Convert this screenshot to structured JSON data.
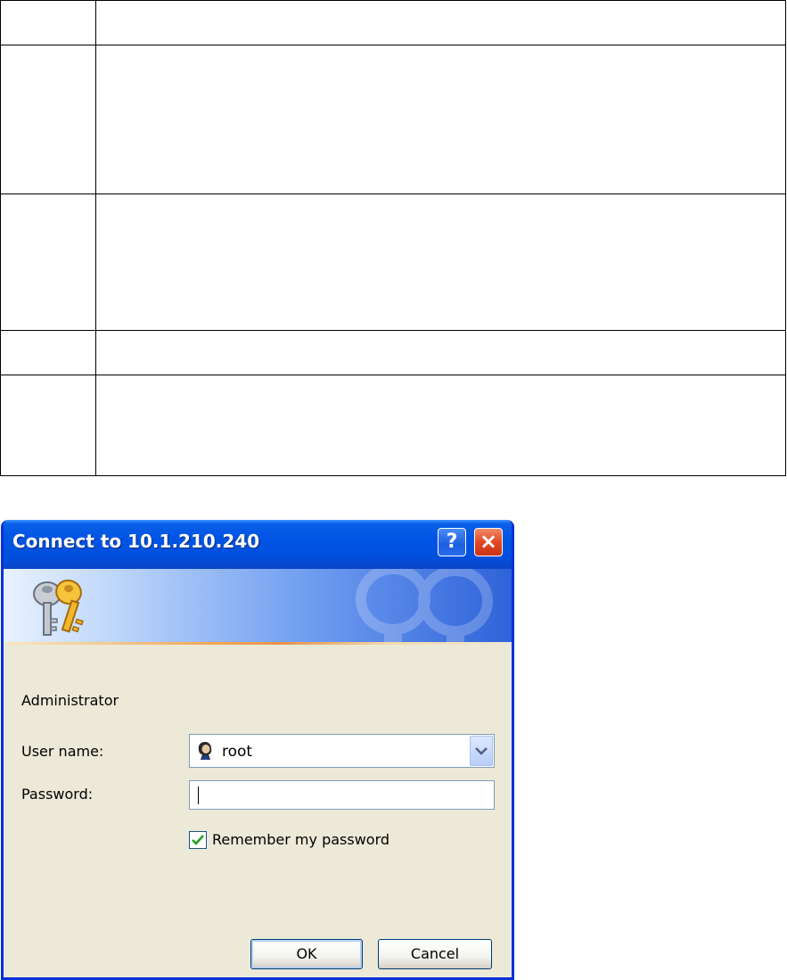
{
  "document": {
    "rows": 5
  },
  "dialog": {
    "title": "Connect to 10.1.210.240",
    "help_button": "?",
    "close_button": "×",
    "realm": "Administrator",
    "username_label": "User name:",
    "username_value": "root",
    "password_label": "Password:",
    "password_value": "",
    "remember_label": "Remember my password",
    "remember_checked": true,
    "ok_label": "OK",
    "cancel_label": "Cancel",
    "icons": {
      "banner": "keys-icon",
      "user": "user-icon",
      "dropdown": "chevron-down-icon"
    },
    "colors": {
      "titlebar": "#0054e3",
      "body": "#ece9d8",
      "close": "#e0441c"
    }
  }
}
